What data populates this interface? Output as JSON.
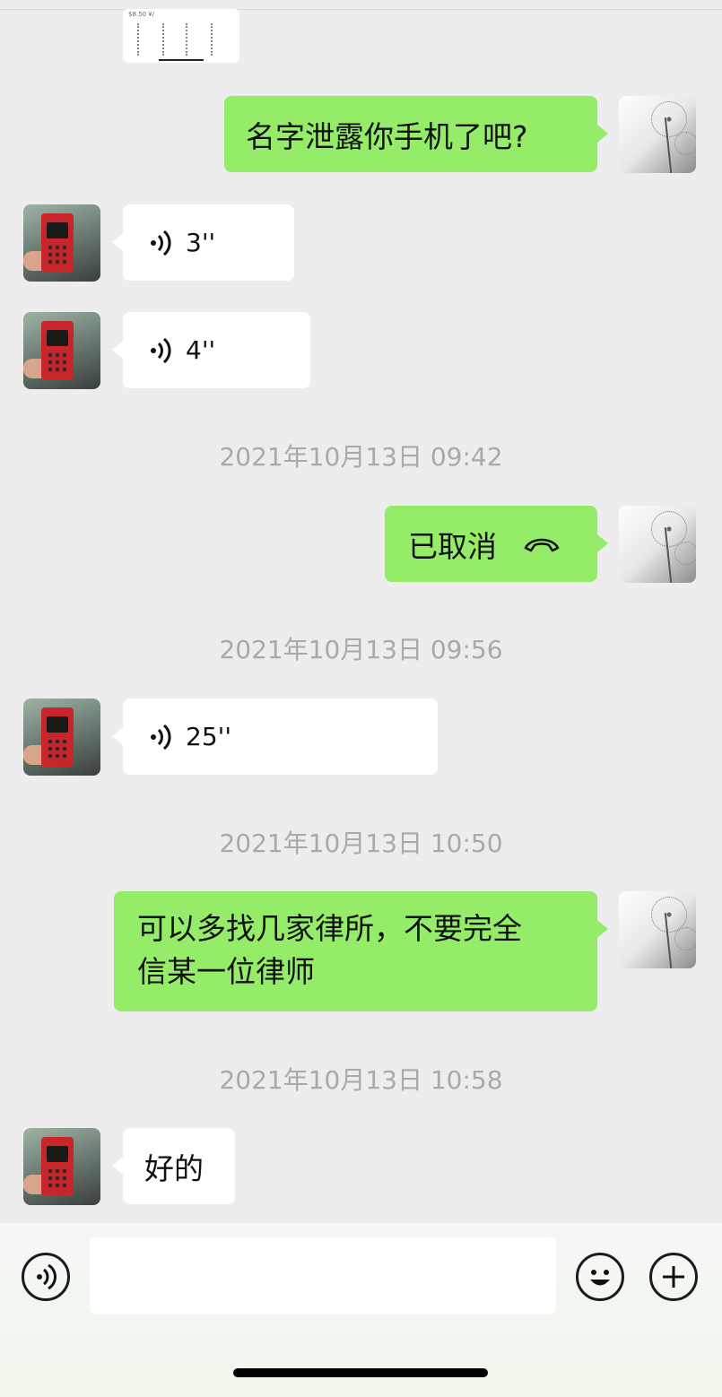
{
  "messages": {
    "m1": {
      "text": "名字泄露你手机了吧?"
    },
    "m2": {
      "duration": "3''"
    },
    "m3": {
      "duration": "4''"
    },
    "t1": "2021年10月13日 09:42",
    "m4": {
      "text": "已取消"
    },
    "t2": "2021年10月13日 09:56",
    "m5": {
      "duration": "25''"
    },
    "t3": "2021年10月13日 10:50",
    "m6": {
      "line1": "可以多找几家律所，不要完全",
      "line2": "信某一位律师"
    },
    "t4": "2021年10月13日 10:58",
    "m7": {
      "text": "好的"
    }
  },
  "thumb": {
    "caption": "$8.50 ¥/"
  },
  "input": {
    "placeholder": ""
  },
  "colors": {
    "outgoing_bubble": "#95ec69",
    "incoming_bubble": "#ffffff",
    "background": "#ededed",
    "timestamp": "#a9a9a9"
  },
  "icons": [
    "voice-input-icon",
    "emoji-icon",
    "add-icon",
    "voice-wave-icon",
    "hangup-icon"
  ]
}
